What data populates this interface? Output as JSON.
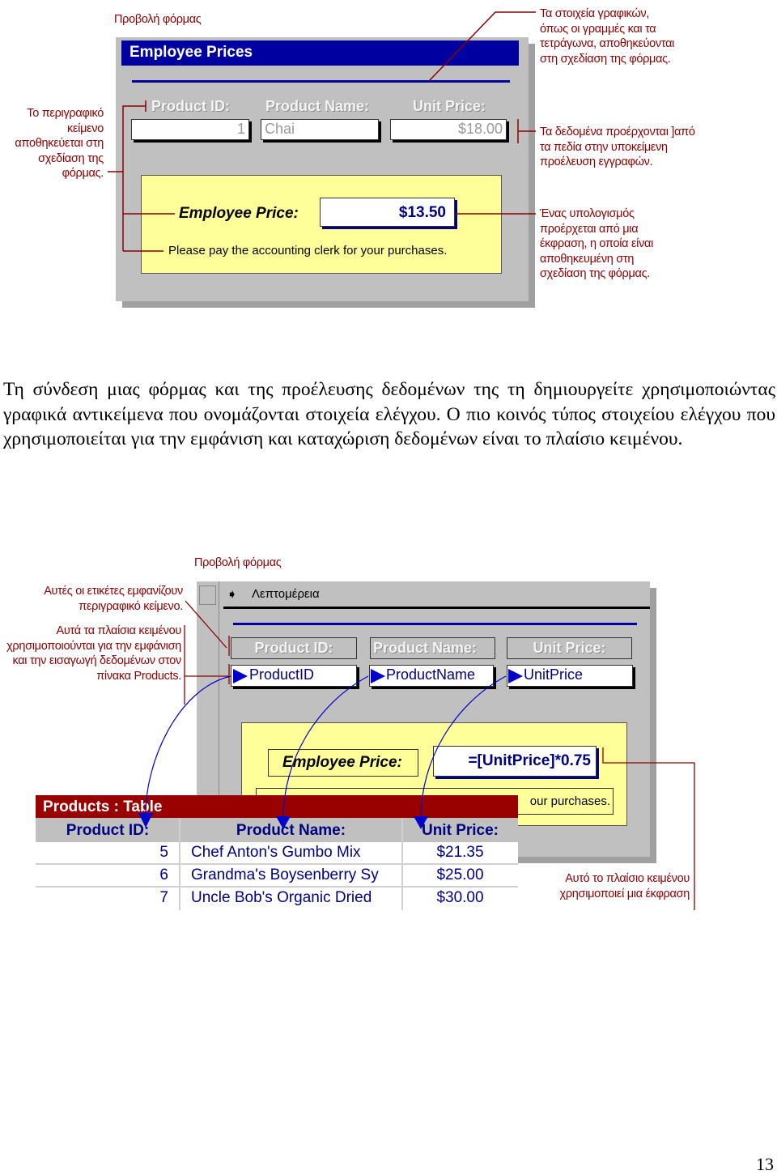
{
  "figure1": {
    "caption": "Προβολή φόρμας",
    "form_title": "Employee Prices",
    "labels": [
      "Product ID:",
      "Product Name:",
      "Unit Price:"
    ],
    "values": [
      "1",
      "Chai",
      "$18.00"
    ],
    "employee_price_label": "Employee Price:",
    "employee_price_value": "$13.50",
    "note": "Please pay the accounting clerk for your purchases.",
    "annotations": {
      "left": "Το περιγραφικό κείμενο αποθηκεύεται στη σχεδίαση της φόρμας.",
      "top_right": "Τα στοιχεία γραφικών, όπως οι γραμμές και τα τετράγωνα, αποθηκεύονται στη σχεδίαση της φόρμας.",
      "middle_right": "Τα δεδομένα προέρχονται ]από τα πεδία στην υποκείμενη προέλευση εγγραφών.",
      "bottom_right": "Ένας υπολογισμός προέρχεται από μια έκφραση, η οποία είναι αποθηκευμένη στη σχεδίαση της φόρμας."
    }
  },
  "paragraph": "Τη σύνδεση μιας φόρμας και της προέλευσης δεδομένων της τη δημιουργείτε χρησιμοποιώντας γραφικά αντικείμενα που ονομάζονται στοιχεία ελέγχου. Ο πιο κοινός τύπος στοιχείου ελέγχου που χρησιμοποιείται για την εμφάνιση και καταχώριση δεδομένων είναι το πλαίσιο κειμένου.",
  "figure2": {
    "caption": "Προβολή φόρμας",
    "section": "Λεπτομέρεια",
    "labels": [
      "Product ID:",
      "Product Name:",
      "Unit Price:"
    ],
    "fields": [
      "ProductID",
      "ProductName",
      "UnitPrice"
    ],
    "employee_price_label": "Employee Price:",
    "expression": "=[UnitPrice]*0.75",
    "note_visible": "our purchases.",
    "table": {
      "title": "Products : Table",
      "headers": [
        "Product ID:",
        "Product Name:",
        "Unit Price:"
      ],
      "rows": [
        [
          "5",
          "Chef Anton's Gumbo Mix",
          "$21.35"
        ],
        [
          "6",
          "Grandma's Boysenberry Sy",
          "$25.00"
        ],
        [
          "7",
          "Uncle Bob's Organic Dried",
          "$30.00"
        ]
      ]
    },
    "annotations": {
      "labels_note": "Αυτές οι ετικέτες εμφανίζουν περιγραφικό κείμενο.",
      "textboxes_note": "Αυτά τα πλαίσια κειμένου χρησιμοποιούνται για την εμφάνιση και την εισαγωγή δεδομένων στον πίνακα Products.",
      "expression_note": "Αυτό το πλαίσιο κειμένου χρησιμοποιεί μια έκφραση"
    }
  },
  "page_number": "13",
  "colors": {
    "annotation": "#8b0000",
    "title_bar": "#0000a0",
    "table_title": "#990000",
    "form_bg": "#c0c0c0",
    "highlight": "#ffff99"
  }
}
